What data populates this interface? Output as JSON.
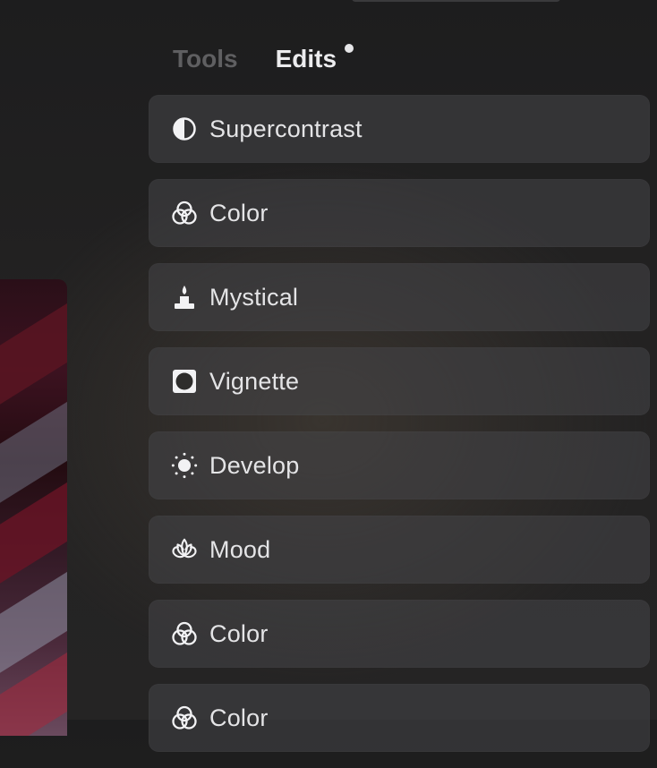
{
  "tabs": [
    {
      "label": "Tools",
      "active": false
    },
    {
      "label": "Edits",
      "active": true,
      "has_indicator": true
    }
  ],
  "edits": [
    {
      "label": "Supercontrast",
      "icon": "contrast-icon"
    },
    {
      "label": "Color",
      "icon": "color-circles-icon"
    },
    {
      "label": "Mystical",
      "icon": "candle-icon"
    },
    {
      "label": "Vignette",
      "icon": "vignette-icon"
    },
    {
      "label": "Develop",
      "icon": "sun-icon"
    },
    {
      "label": "Mood",
      "icon": "lotus-icon"
    },
    {
      "label": "Color",
      "icon": "color-circles-icon"
    },
    {
      "label": "Color",
      "icon": "color-circles-icon"
    }
  ],
  "colors": {
    "panel_item_bg": "#464648",
    "text_primary": "#e4e4e6",
    "tab_inactive": "#5f5f61",
    "tab_active": "#ececee"
  }
}
